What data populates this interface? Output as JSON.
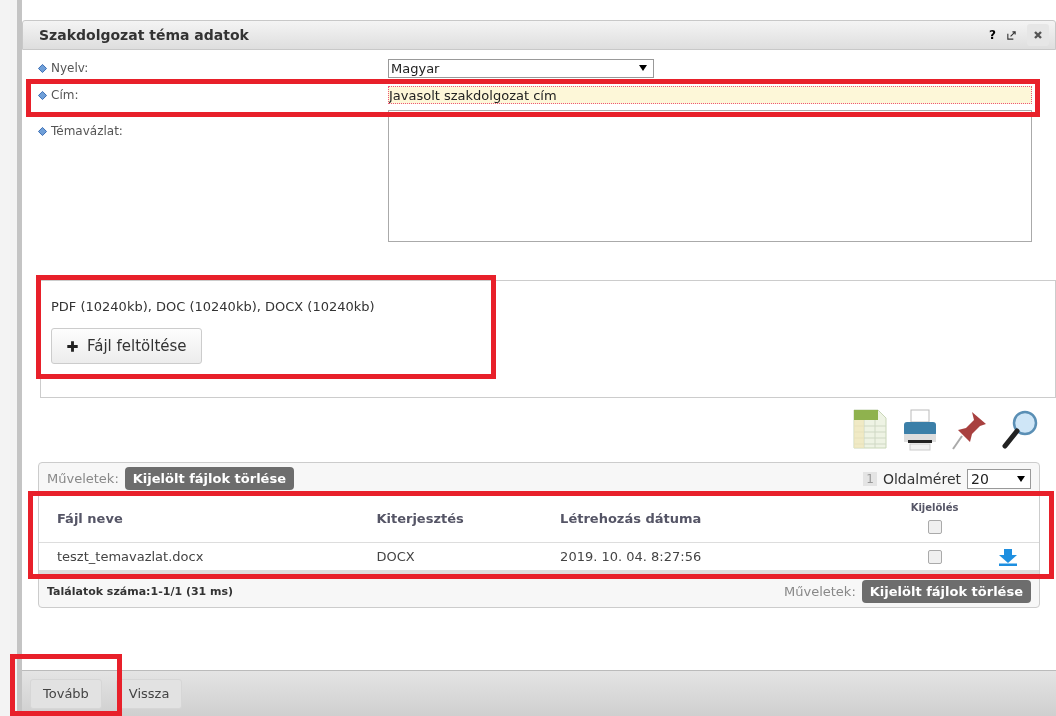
{
  "dialog": {
    "title": "Szakdolgozat téma adatok",
    "header_buttons": [
      "?"
    ]
  },
  "form": [
    {
      "kind": "select",
      "label": "Nyelv:",
      "value": "Magyar"
    },
    {
      "kind": "text",
      "label": "Cím:",
      "value": "Javasolt szakdolgozat cím"
    },
    {
      "kind": "textarea",
      "label": "Témavázlat:"
    }
  ],
  "upload": {
    "allowed_types": "PDF (10240kb), DOC (10240kb), DOCX (10240kb)",
    "button": "Fájl feltöltése"
  },
  "grid": {
    "actions_label": "Műveletek:",
    "delete_button": "Kijelölt fájlok törlése",
    "page": "1",
    "page_size_label": "Oldalméret",
    "page_size": "20",
    "columns": [
      "Fájl neve",
      "Kiterjesztés",
      "Létrehozás dátuma",
      "Kijelölés"
    ],
    "select_all_checked": false,
    "rows": [
      {
        "cells": [
          "teszt_temavazlat.docx",
          "DOCX",
          "2019. 10. 04. 8:27:56"
        ],
        "checked": false
      }
    ],
    "results": "Találatok száma:1-1/1 (31 ms)",
    "footer_actions_label": "Műveletek:",
    "footer_delete_button": "Kijelölt fájlok törlése"
  },
  "footer_buttons": [
    {
      "label": "Tovább"
    },
    {
      "label": "Vissza"
    }
  ]
}
